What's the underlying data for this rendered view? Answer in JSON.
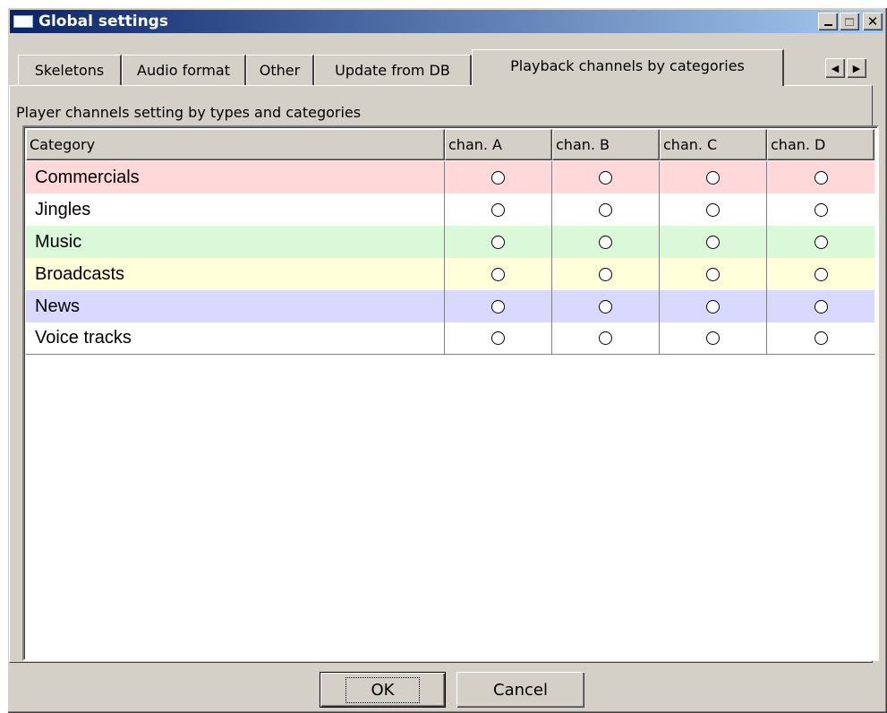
{
  "window": {
    "title": "Global settings",
    "controls": [
      "minimize-icon",
      "maximize-icon",
      "close-icon"
    ]
  },
  "tabs": [
    {
      "label": "Skeletons",
      "active": false
    },
    {
      "label": "Audio format",
      "active": false
    },
    {
      "label": "Other",
      "active": false
    },
    {
      "label": "Update from DB",
      "active": false
    },
    {
      "label": "Playback channels by categories",
      "active": true
    }
  ],
  "panel": {
    "caption": "Player channels setting by types and categories"
  },
  "grid": {
    "columns": [
      "Category",
      "chan. A",
      "chan. B",
      "chan. C",
      "chan. D"
    ],
    "rows": [
      {
        "label": "Commercials",
        "color": "#ffd9d9"
      },
      {
        "label": "Jingles",
        "color": "#ffffff"
      },
      {
        "label": "Music",
        "color": "#d9f9d9"
      },
      {
        "label": "Broadcasts",
        "color": "#ffffd9"
      },
      {
        "label": "News",
        "color": "#d9d9ff"
      },
      {
        "label": "Voice tracks",
        "color": "#ffffff"
      }
    ]
  },
  "buttons": {
    "ok": "OK",
    "cancel": "Cancel"
  }
}
